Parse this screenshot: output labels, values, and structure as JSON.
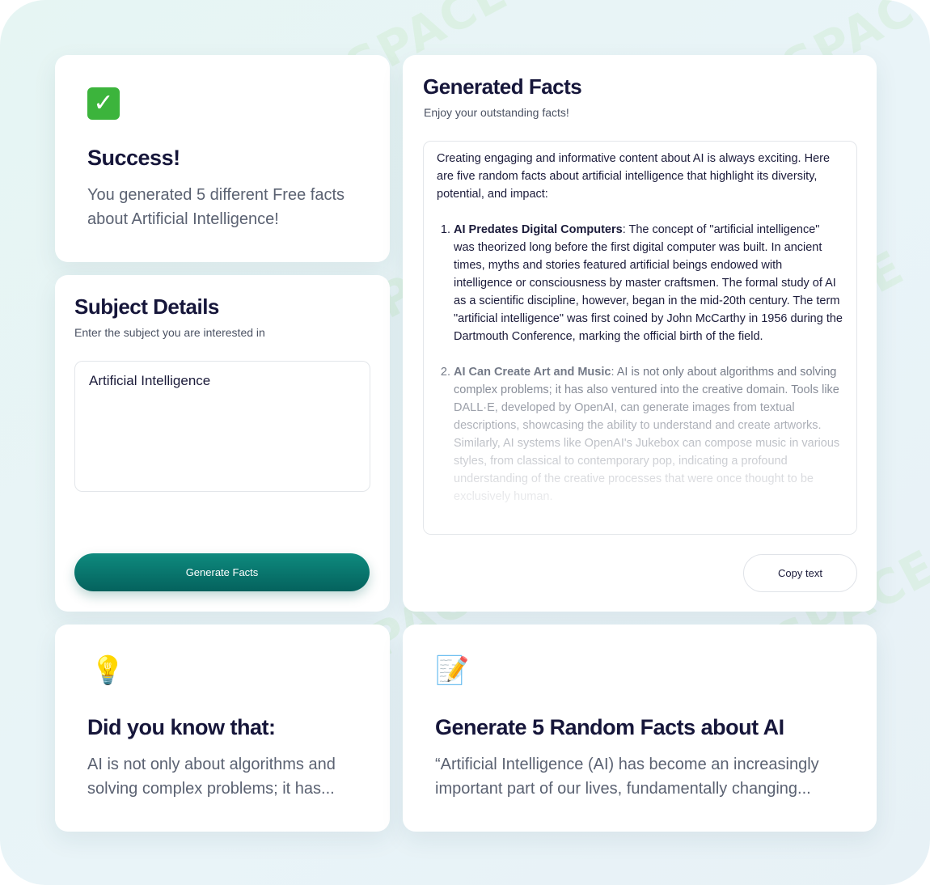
{
  "success_card": {
    "icon": "check-mark-icon",
    "title": "Success!",
    "message": "You generated 5 different Free facts about Artificial Intelligence!"
  },
  "subject_card": {
    "title": "Subject Details",
    "subtitle": "Enter the subject you are interested in",
    "input_value": "Artificial Intelligence",
    "button_label": "Generate Facts"
  },
  "facts_card": {
    "title": "Generated Facts",
    "subtitle": "Enjoy your outstanding facts!",
    "intro": "Creating engaging and informative content about AI is always exciting. Here are five random facts about artificial intelligence that highlight its diversity, potential, and impact:",
    "facts": [
      {
        "heading": "AI Predates Digital Computers",
        "text": ": The concept of \"artificial intelligence\" was theorized long before the first digital computer was built. In ancient times, myths and stories featured artificial beings endowed with intelligence or consciousness by master craftsmen. The formal study of AI as a scientific discipline, however, began in the mid-20th century. The term \"artificial intelligence\" was first coined by John McCarthy in 1956 during the Dartmouth Conference, marking the official birth of the field."
      },
      {
        "heading": "AI Can Create Art and Music",
        "text": ": AI is not only about algorithms and solving complex problems; it has also ventured into the creative domain. Tools like DALL·E, developed by OpenAI, can generate images from textual descriptions, showcasing the ability to understand and create artworks. Similarly, AI systems like OpenAI's Jukebox can compose music in various styles, from classical to contemporary pop, indicating a profound understanding of the creative processes that were once thought to be exclusively human."
      }
    ],
    "copy_label": "Copy text"
  },
  "did_you_know_card": {
    "icon": "light-bulb-icon",
    "title": "Did you know that:",
    "text": "AI is not only about algorithms and solving complex problems; it has..."
  },
  "random_facts_card": {
    "icon": "memo-pencil-icon",
    "title": "Generate 5 Random Facts about AI",
    "text": "“Artificial Intelligence (AI) has become an increasingly important part of our lives, fundamentally changing..."
  },
  "watermark_text": "AI TALENT SPACE"
}
